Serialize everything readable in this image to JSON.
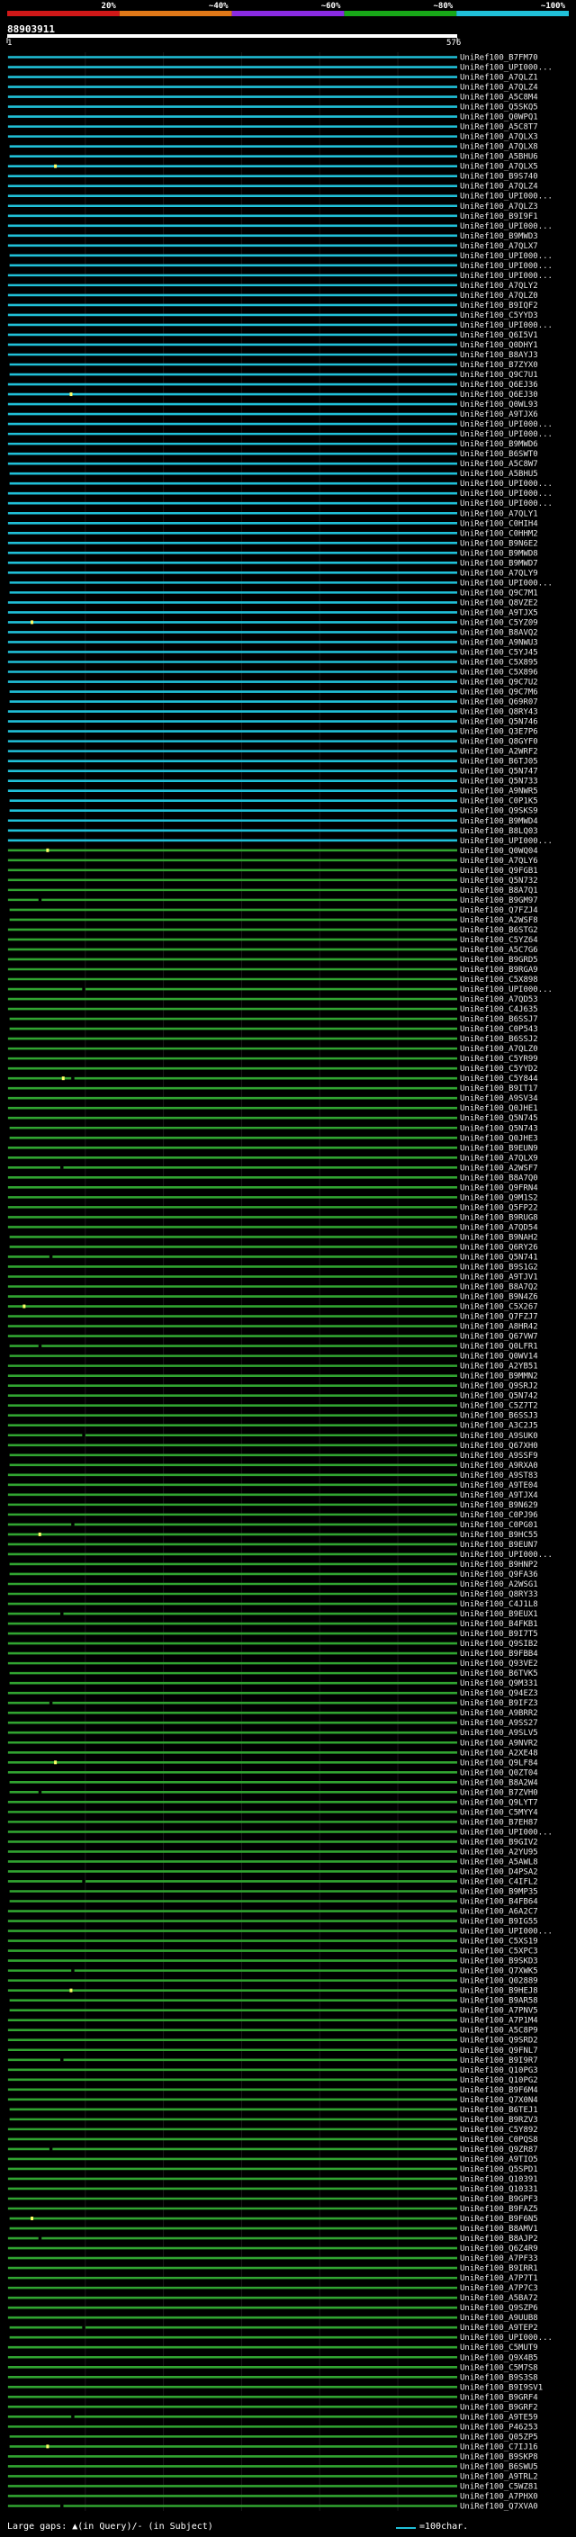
{
  "query": {
    "id": "88903911",
    "start": "1",
    "end": "576"
  },
  "scale_bar": {
    "ticks": [
      "20%",
      "~40%",
      "~60%",
      "~80%",
      "~100%"
    ],
    "colors": [
      "#d01818",
      "#e07818",
      "#8a2be2",
      "#18a818",
      "#20c0d8"
    ]
  },
  "colors": {
    "high": "#20c0d8",
    "mid": "#31a431",
    "gap_line": "#000000",
    "marker": "#ffff66"
  },
  "legend": {
    "gaps": "Large gaps: ▲(in Query)/- (in Subject)",
    "scale": "=100char."
  },
  "chart_data": {
    "type": "alignment_overview",
    "query_length": 576,
    "subjects": [
      {
        "name": "UniRef100_B7FM70",
        "class": "high"
      },
      {
        "name": "UniRef100_UPI000...",
        "class": "high"
      },
      {
        "name": "UniRef100_A7QLZ1",
        "class": "high"
      },
      {
        "name": "UniRef100_A7QLZ4",
        "class": "high"
      },
      {
        "name": "UniRef100_A5C8M4",
        "class": "high"
      },
      {
        "name": "UniRef100_Q5SKQ5",
        "class": "high"
      },
      {
        "name": "UniRef100_Q0WPQ1",
        "class": "high"
      },
      {
        "name": "UniRef100_A5C8T7",
        "class": "high"
      },
      {
        "name": "UniRef100_A7QLX3",
        "class": "high"
      },
      {
        "name": "UniRef100_A7QLX8",
        "class": "high"
      },
      {
        "name": "UniRef100_A5BHU6",
        "class": "high"
      },
      {
        "name": "UniRef100_A7QLX5",
        "class": "high"
      },
      {
        "name": "UniRef100_B9S740",
        "class": "high"
      },
      {
        "name": "UniRef100_A7QLZ4",
        "class": "high"
      },
      {
        "name": "UniRef100_UPI000...",
        "class": "high"
      },
      {
        "name": "UniRef100_A7QLZ3",
        "class": "high"
      },
      {
        "name": "UniRef100_B9I9F1",
        "class": "high"
      },
      {
        "name": "UniRef100_UPI000...",
        "class": "high"
      },
      {
        "name": "UniRef100_B9MWD3",
        "class": "high"
      },
      {
        "name": "UniRef100_A7QLX7",
        "class": "high"
      },
      {
        "name": "UniRef100_UPI000...",
        "class": "high"
      },
      {
        "name": "UniRef100_UPI000...",
        "class": "high"
      },
      {
        "name": "UniRef100_UPI000...",
        "class": "high"
      },
      {
        "name": "UniRef100_A7QLY2",
        "class": "high"
      },
      {
        "name": "UniRef100_A7QLZ0",
        "class": "high"
      },
      {
        "name": "UniRef100_B9IQF2",
        "class": "high"
      },
      {
        "name": "UniRef100_C5YYD3",
        "class": "high"
      },
      {
        "name": "UniRef100_UPI000...",
        "class": "high"
      },
      {
        "name": "UniRef100_Q6I5V1",
        "class": "high"
      },
      {
        "name": "UniRef100_Q0DHY1",
        "class": "high"
      },
      {
        "name": "UniRef100_B8AYJ3",
        "class": "high"
      },
      {
        "name": "UniRef100_B7ZYX0",
        "class": "high"
      },
      {
        "name": "UniRef100_Q9C7U1",
        "class": "high"
      },
      {
        "name": "UniRef100_Q6EJ36",
        "class": "high"
      },
      {
        "name": "UniRef100_Q6EJ30",
        "class": "high"
      },
      {
        "name": "UniRef100_Q0WL93",
        "class": "high"
      },
      {
        "name": "UniRef100_A9TJX6",
        "class": "high"
      },
      {
        "name": "UniRef100_UPI000...",
        "class": "high"
      },
      {
        "name": "UniRef100_UPI000...",
        "class": "high"
      },
      {
        "name": "UniRef100_B9MWD6",
        "class": "high"
      },
      {
        "name": "UniRef100_B6SWT0",
        "class": "high"
      },
      {
        "name": "UniRef100_A5C8W7",
        "class": "high"
      },
      {
        "name": "UniRef100_A5BHU5",
        "class": "high"
      },
      {
        "name": "UniRef100_UPI000...",
        "class": "high"
      },
      {
        "name": "UniRef100_UPI000...",
        "class": "high"
      },
      {
        "name": "UniRef100_UPI000...",
        "class": "high"
      },
      {
        "name": "UniRef100_A7QLY1",
        "class": "high"
      },
      {
        "name": "UniRef100_C0HIH4",
        "class": "high"
      },
      {
        "name": "UniRef100_C0HHM2",
        "class": "high"
      },
      {
        "name": "UniRef100_B9N6E2",
        "class": "high"
      },
      {
        "name": "UniRef100_B9MWD8",
        "class": "high"
      },
      {
        "name": "UniRef100_B9MWD7",
        "class": "high"
      },
      {
        "name": "UniRef100_A7QLY9",
        "class": "high"
      },
      {
        "name": "UniRef100_UPI000...",
        "class": "high"
      },
      {
        "name": "UniRef100_Q9C7M1",
        "class": "high"
      },
      {
        "name": "UniRef100_Q8VZE2",
        "class": "high"
      },
      {
        "name": "UniRef100_A9TJX5",
        "class": "high"
      },
      {
        "name": "UniRef100_C5YZ09",
        "class": "high"
      },
      {
        "name": "UniRef100_B8AVQ2",
        "class": "high"
      },
      {
        "name": "UniRef100_A9NWU3",
        "class": "high"
      },
      {
        "name": "UniRef100_C5YJ45",
        "class": "high"
      },
      {
        "name": "UniRef100_C5X895",
        "class": "high"
      },
      {
        "name": "UniRef100_C5X896",
        "class": "high"
      },
      {
        "name": "UniRef100_Q9C7U2",
        "class": "high"
      },
      {
        "name": "UniRef100_Q9C7M6",
        "class": "high"
      },
      {
        "name": "UniRef100_Q69R07",
        "class": "high"
      },
      {
        "name": "UniRef100_Q8RY43",
        "class": "high"
      },
      {
        "name": "UniRef100_Q5N746",
        "class": "high"
      },
      {
        "name": "UniRef100_Q3E7P6",
        "class": "high"
      },
      {
        "name": "UniRef100_Q8GYF0",
        "class": "high"
      },
      {
        "name": "UniRef100_A2WRF2",
        "class": "high"
      },
      {
        "name": "UniRef100_B6TJ05",
        "class": "high"
      },
      {
        "name": "UniRef100_Q5N747",
        "class": "high"
      },
      {
        "name": "UniRef100_Q5N733",
        "class": "high"
      },
      {
        "name": "UniRef100_A9NWR5",
        "class": "high"
      },
      {
        "name": "UniRef100_C0P1K5",
        "class": "high"
      },
      {
        "name": "UniRef100_Q9SKS9",
        "class": "high"
      },
      {
        "name": "UniRef100_B9MWD4",
        "class": "high"
      },
      {
        "name": "UniRef100_B8LQ03",
        "class": "high"
      },
      {
        "name": "UniRef100_UPI000...",
        "class": "high"
      },
      {
        "name": "UniRef100_Q0WQ04",
        "class": "mid"
      },
      {
        "name": "UniRef100_A7QLY6",
        "class": "mid"
      },
      {
        "name": "UniRef100_Q9FGB1",
        "class": "mid"
      },
      {
        "name": "UniRef100_Q5N732",
        "class": "mid"
      },
      {
        "name": "UniRef100_B8A7Q1",
        "class": "mid"
      },
      {
        "name": "UniRef100_B9GM97",
        "class": "mid"
      },
      {
        "name": "UniRef100_Q7FZJ4",
        "class": "mid"
      },
      {
        "name": "UniRef100_A2WSF8",
        "class": "mid"
      },
      {
        "name": "UniRef100_B6STG2",
        "class": "mid"
      },
      {
        "name": "UniRef100_C5YZ64",
        "class": "mid"
      },
      {
        "name": "UniRef100_A5C7G6",
        "class": "mid"
      },
      {
        "name": "UniRef100_B9GRD5",
        "class": "mid"
      },
      {
        "name": "UniRef100_B9RGA9",
        "class": "mid"
      },
      {
        "name": "UniRef100_C5X898",
        "class": "mid"
      },
      {
        "name": "UniRef100_UPI000...",
        "class": "mid"
      },
      {
        "name": "UniRef100_A7QD53",
        "class": "mid"
      },
      {
        "name": "UniRef100_C4J635",
        "class": "mid"
      },
      {
        "name": "UniRef100_B6SSJ7",
        "class": "mid"
      },
      {
        "name": "UniRef100_C0P543",
        "class": "mid"
      },
      {
        "name": "UniRef100_B6SSJ2",
        "class": "mid"
      },
      {
        "name": "UniRef100_A7QLZ0",
        "class": "mid"
      },
      {
        "name": "UniRef100_C5YR99",
        "class": "mid"
      },
      {
        "name": "UniRef100_C5YYD2",
        "class": "mid"
      },
      {
        "name": "UniRef100_C5Y844",
        "class": "mid"
      },
      {
        "name": "UniRef100_B9IT17",
        "class": "mid"
      },
      {
        "name": "UniRef100_A9SV34",
        "class": "mid"
      },
      {
        "name": "UniRef100_Q0JHE1",
        "class": "mid"
      },
      {
        "name": "UniRef100_Q5N745",
        "class": "mid"
      },
      {
        "name": "UniRef100_Q5N743",
        "class": "mid"
      },
      {
        "name": "UniRef100_Q0JHE3",
        "class": "mid"
      },
      {
        "name": "UniRef100_B9EUN9",
        "class": "mid"
      },
      {
        "name": "UniRef100_A7QLX9",
        "class": "mid"
      },
      {
        "name": "UniRef100_A2WSF7",
        "class": "mid"
      },
      {
        "name": "UniRef100_B8A7Q0",
        "class": "mid"
      },
      {
        "name": "UniRef100_Q9FRN4",
        "class": "mid"
      },
      {
        "name": "UniRef100_Q9M1S2",
        "class": "mid"
      },
      {
        "name": "UniRef100_Q5FP22",
        "class": "mid"
      },
      {
        "name": "UniRef100_B9RUG8",
        "class": "mid"
      },
      {
        "name": "UniRef100_A7QD54",
        "class": "mid"
      },
      {
        "name": "UniRef100_B9NAH2",
        "class": "mid"
      },
      {
        "name": "UniRef100_Q6RY26",
        "class": "mid"
      },
      {
        "name": "UniRef100_Q5N741",
        "class": "mid"
      },
      {
        "name": "UniRef100_B9S1G2",
        "class": "mid"
      },
      {
        "name": "UniRef100_A9TJV1",
        "class": "mid"
      },
      {
        "name": "UniRef100_B8A7Q2",
        "class": "mid"
      },
      {
        "name": "UniRef100_B9N4Z6",
        "class": "mid"
      },
      {
        "name": "UniRef100_C5X267",
        "class": "mid"
      },
      {
        "name": "UniRef100_Q7FZJ7",
        "class": "mid"
      },
      {
        "name": "UniRef100_A8HR42",
        "class": "mid"
      },
      {
        "name": "UniRef100_Q67VW7",
        "class": "mid"
      },
      {
        "name": "UniRef100_Q0LFR1",
        "class": "mid"
      },
      {
        "name": "UniRef100_Q0WV14",
        "class": "mid"
      },
      {
        "name": "UniRef100_A2YB51",
        "class": "mid"
      },
      {
        "name": "UniRef100_B9MMN2",
        "class": "mid"
      },
      {
        "name": "UniRef100_Q9SRJ2",
        "class": "mid"
      },
      {
        "name": "UniRef100_Q5N742",
        "class": "mid"
      },
      {
        "name": "UniRef100_C5Z7T2",
        "class": "mid"
      },
      {
        "name": "UniRef100_B6SSJ3",
        "class": "mid"
      },
      {
        "name": "UniRef100_A3C2J5",
        "class": "mid"
      },
      {
        "name": "UniRef100_A9SUK0",
        "class": "mid"
      },
      {
        "name": "UniRef100_Q67XH0",
        "class": "mid"
      },
      {
        "name": "UniRef100_A9SSF9",
        "class": "mid"
      },
      {
        "name": "UniRef100_A9RXA0",
        "class": "mid"
      },
      {
        "name": "UniRef100_A9ST83",
        "class": "mid"
      },
      {
        "name": "UniRef100_A9TE04",
        "class": "mid"
      },
      {
        "name": "UniRef100_A9TJX4",
        "class": "mid"
      },
      {
        "name": "UniRef100_B9N629",
        "class": "mid"
      },
      {
        "name": "UniRef100_C0PJ96",
        "class": "mid"
      },
      {
        "name": "UniRef100_C0PG01",
        "class": "mid"
      },
      {
        "name": "UniRef100_B9HC55",
        "class": "mid"
      },
      {
        "name": "UniRef100_B9EUN7",
        "class": "mid"
      },
      {
        "name": "UniRef100_UPI000...",
        "class": "mid"
      },
      {
        "name": "UniRef100_B9HNP2",
        "class": "mid"
      },
      {
        "name": "UniRef100_Q9FA36",
        "class": "mid"
      },
      {
        "name": "UniRef100_A2WSG1",
        "class": "mid"
      },
      {
        "name": "UniRef100_Q8RY33",
        "class": "mid"
      },
      {
        "name": "UniRef100_C4J1L8",
        "class": "mid"
      },
      {
        "name": "UniRef100_B9EUX1",
        "class": "mid"
      },
      {
        "name": "UniRef100_B4FKB1",
        "class": "mid"
      },
      {
        "name": "UniRef100_B9I7T5",
        "class": "mid"
      },
      {
        "name": "UniRef100_Q9SIB2",
        "class": "mid"
      },
      {
        "name": "UniRef100_B9FBB4",
        "class": "mid"
      },
      {
        "name": "UniRef100_Q93VE2",
        "class": "mid"
      },
      {
        "name": "UniRef100_B6TVK5",
        "class": "mid"
      },
      {
        "name": "UniRef100_Q9M331",
        "class": "mid"
      },
      {
        "name": "UniRef100_Q94EZ3",
        "class": "mid"
      },
      {
        "name": "UniRef100_B9IFZ3",
        "class": "mid"
      },
      {
        "name": "UniRef100_A9BRR2",
        "class": "mid"
      },
      {
        "name": "UniRef100_A9SS27",
        "class": "mid"
      },
      {
        "name": "UniRef100_A9SLV5",
        "class": "mid"
      },
      {
        "name": "UniRef100_A9NVR2",
        "class": "mid"
      },
      {
        "name": "UniRef100_A2XE48",
        "class": "mid"
      },
      {
        "name": "UniRef100_Q9LF84",
        "class": "mid"
      },
      {
        "name": "UniRef100_Q0ZT04",
        "class": "mid"
      },
      {
        "name": "UniRef100_B8A2W4",
        "class": "mid"
      },
      {
        "name": "UniRef100_B7ZVH0",
        "class": "mid"
      },
      {
        "name": "UniRef100_Q9LYT7",
        "class": "mid"
      },
      {
        "name": "UniRef100_C5MYY4",
        "class": "mid"
      },
      {
        "name": "UniRef100_B7EH87",
        "class": "mid"
      },
      {
        "name": "UniRef100_UPI000...",
        "class": "mid"
      },
      {
        "name": "UniRef100_B9GIV2",
        "class": "mid"
      },
      {
        "name": "UniRef100_A2YU95",
        "class": "mid"
      },
      {
        "name": "UniRef100_A5AWL8",
        "class": "mid"
      },
      {
        "name": "UniRef100_D4PSA2",
        "class": "mid"
      },
      {
        "name": "UniRef100_C4IFL2",
        "class": "mid"
      },
      {
        "name": "UniRef100_B9MP35",
        "class": "mid"
      },
      {
        "name": "UniRef100_B4FB64",
        "class": "mid"
      },
      {
        "name": "UniRef100_A6A2C7",
        "class": "mid"
      },
      {
        "name": "UniRef100_B9IG55",
        "class": "mid"
      },
      {
        "name": "UniRef100_UPI000...",
        "class": "mid"
      },
      {
        "name": "UniRef100_C5XS19",
        "class": "mid"
      },
      {
        "name": "UniRef100_C5XPC3",
        "class": "mid"
      },
      {
        "name": "UniRef100_B9SKD3",
        "class": "mid"
      },
      {
        "name": "UniRef100_Q7XWK5",
        "class": "mid"
      },
      {
        "name": "UniRef100_Q02889",
        "class": "mid"
      },
      {
        "name": "UniRef100_B9HEJ8",
        "class": "mid"
      },
      {
        "name": "UniRef100_B9AR58",
        "class": "mid"
      },
      {
        "name": "UniRef100_A7PNV5",
        "class": "mid"
      },
      {
        "name": "UniRef100_A7P1M4",
        "class": "mid"
      },
      {
        "name": "UniRef100_A5C8P9",
        "class": "mid"
      },
      {
        "name": "UniRef100_Q9SRD2",
        "class": "mid"
      },
      {
        "name": "UniRef100_Q9FNL7",
        "class": "mid"
      },
      {
        "name": "UniRef100_B9I9R7",
        "class": "mid"
      },
      {
        "name": "UniRef100_Q10PG3",
        "class": "mid"
      },
      {
        "name": "UniRef100_Q10PG2",
        "class": "mid"
      },
      {
        "name": "UniRef100_B9F6M4",
        "class": "mid"
      },
      {
        "name": "UniRef100_Q7X0N4",
        "class": "mid"
      },
      {
        "name": "UniRef100_B6TEJ1",
        "class": "mid"
      },
      {
        "name": "UniRef100_B9RZV3",
        "class": "mid"
      },
      {
        "name": "UniRef100_C5Y892",
        "class": "mid"
      },
      {
        "name": "UniRef100_C0PQS8",
        "class": "mid"
      },
      {
        "name": "UniRef100_Q9ZR87",
        "class": "mid"
      },
      {
        "name": "UniRef100_A9TIO5",
        "class": "mid"
      },
      {
        "name": "UniRef100_Q5SPD1",
        "class": "mid"
      },
      {
        "name": "UniRef100_Q10391",
        "class": "mid"
      },
      {
        "name": "UniRef100_Q10331",
        "class": "mid"
      },
      {
        "name": "UniRef100_B9GPF3",
        "class": "mid"
      },
      {
        "name": "UniRef100_B9FAZ5",
        "class": "mid"
      },
      {
        "name": "UniRef100_B9F6N5",
        "class": "mid"
      },
      {
        "name": "UniRef100_B8AMV1",
        "class": "mid"
      },
      {
        "name": "UniRef100_B8AJP2",
        "class": "mid"
      },
      {
        "name": "UniRef100_Q6Z4R9",
        "class": "mid"
      },
      {
        "name": "UniRef100_A7PF33",
        "class": "mid"
      },
      {
        "name": "UniRef100_B9IRR1",
        "class": "mid"
      },
      {
        "name": "UniRef100_A7P7T1",
        "class": "mid"
      },
      {
        "name": "UniRef100_A7P7C3",
        "class": "mid"
      },
      {
        "name": "UniRef100_A5BA72",
        "class": "mid"
      },
      {
        "name": "UniRef100_Q9SZP6",
        "class": "mid"
      },
      {
        "name": "UniRef100_A9UUB8",
        "class": "mid"
      },
      {
        "name": "UniRef100_A9TEP2",
        "class": "mid"
      },
      {
        "name": "UniRef100_UPI000...",
        "class": "mid"
      },
      {
        "name": "UniRef100_C5MUT9",
        "class": "mid"
      },
      {
        "name": "UniRef100_Q9X4B5",
        "class": "mid"
      },
      {
        "name": "UniRef100_C5M7S8",
        "class": "mid"
      },
      {
        "name": "UniRef100_B9S3S8",
        "class": "mid"
      },
      {
        "name": "UniRef100_B9I9SV1",
        "class": "mid"
      },
      {
        "name": "UniRef100_B9GRF4",
        "class": "mid"
      },
      {
        "name": "UniRef100_B9GRF2",
        "class": "mid"
      },
      {
        "name": "UniRef100_A9TE59",
        "class": "mid"
      },
      {
        "name": "UniRef100_P46253",
        "class": "mid"
      },
      {
        "name": "UniRef100_Q05ZP5",
        "class": "mid"
      },
      {
        "name": "UniRef100_C7IJ16",
        "class": "mid"
      },
      {
        "name": "UniRef100_B9SKP8",
        "class": "mid"
      },
      {
        "name": "UniRef100_B6SWU5",
        "class": "mid"
      },
      {
        "name": "UniRef100_A9TRL2",
        "class": "mid"
      },
      {
        "name": "UniRef100_C5WZ81",
        "class": "mid"
      },
      {
        "name": "UniRef100_A7PHX0",
        "class": "mid"
      },
      {
        "name": "UniRef100_Q7XVA0",
        "class": "mid"
      }
    ]
  }
}
